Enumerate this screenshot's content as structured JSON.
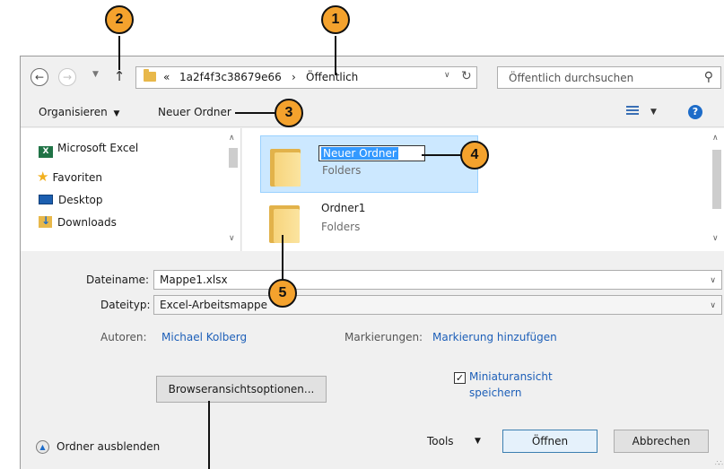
{
  "address_bar": {
    "back_icon": "back-arrow-icon",
    "forward_icon": "forward-arrow-icon",
    "up_icon": "up-arrow-icon",
    "overflow_chevrons": "«",
    "path_segment_1": "1a2f4f3c38679e66",
    "separator": "›",
    "path_segment_2": "Öffentlich",
    "search_placeholder": "Öffentlich durchsuchen"
  },
  "toolbar": {
    "organize_label": "Organisieren",
    "new_folder_label": "Neuer Ordner",
    "help_label": "?"
  },
  "nav_pane": {
    "items": [
      {
        "label": "Microsoft Excel",
        "icon": "excel-icon"
      },
      {
        "label": "Favoriten",
        "icon": "star-icon"
      },
      {
        "label": "Desktop",
        "icon": "desktop-icon"
      },
      {
        "label": "Downloads",
        "icon": "downloads-icon"
      }
    ]
  },
  "files": [
    {
      "name": "Neuer Ordner",
      "type": "Folders",
      "selected": true,
      "renaming": true
    },
    {
      "name": "Ordner1",
      "type": "Folders",
      "selected": false,
      "renaming": false
    }
  ],
  "form": {
    "filename_label": "Dateiname:",
    "filename_value": "Mappe1.xlsx",
    "filetype_label": "Dateityp:",
    "filetype_value": "Excel-Arbeitsmappe",
    "authors_label": "Autoren:",
    "authors_value": "Michael Kolberg",
    "tags_label": "Markierungen:",
    "tags_value": "Markierung hinzufügen",
    "thumbnail_label_line1": "Miniaturansicht",
    "thumbnail_label_line2": "speichern",
    "thumbnail_checked": true,
    "browser_options_label": "Browseransichtsoptionen..."
  },
  "footer": {
    "hide_folders_label": "Ordner ausblenden",
    "tools_label": "Tools",
    "open_label": "Öffnen",
    "cancel_label": "Abbrechen"
  },
  "callouts": [
    "1",
    "2",
    "3",
    "4",
    "5"
  ],
  "colors": {
    "callout_fill": "#f4a22d",
    "selection": "#cce8ff",
    "link": "#1d5fb8",
    "folder": "#e8b84a"
  }
}
